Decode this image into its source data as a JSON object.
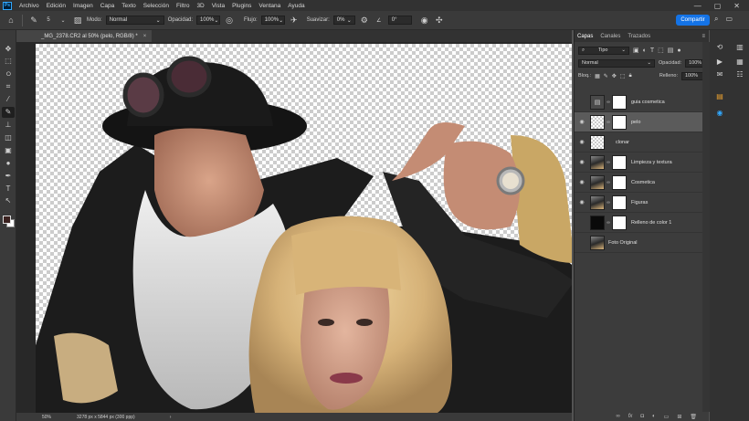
{
  "app": {
    "logo": "Ps"
  },
  "menu": [
    "Archivo",
    "Edición",
    "Imagen",
    "Capa",
    "Texto",
    "Selección",
    "Filtro",
    "3D",
    "Vista",
    "Plugins",
    "Ventana",
    "Ayuda"
  ],
  "window_controls": [
    "—",
    "▢",
    "✕"
  ],
  "options": {
    "brush_size": "5",
    "modo_label": "Modo:",
    "modo_value": "Normal",
    "opacidad_label": "Opacidad:",
    "opacidad_value": "100%",
    "flujo_label": "Flujo:",
    "flujo_value": "100%",
    "suavizar_label": "Suavizar:",
    "suavizar_value": "0%",
    "angle_value": "0°",
    "share_label": "Compartir"
  },
  "document": {
    "tab_title": "_MG_2378.CR2 al 50% (pelo, RGB/8) *",
    "close_symbol": "×",
    "zoom": "50%",
    "info": "3278 px x 5844 px (300 ppp)"
  },
  "colors": {
    "foreground": "#3b2220",
    "background": "#ffffff",
    "accent": "#1473e6"
  },
  "layers_panel": {
    "tabs": [
      "Capas",
      "Canales",
      "Trazados"
    ],
    "filter_label": "Tipo",
    "blend_mode": "Normal",
    "opacity_label": "Opacidad:",
    "opacity_value": "100%",
    "lock_label": "Bloq.:",
    "fill_label": "Relleno:",
    "fill_value": "100%",
    "layers": [
      {
        "name": "guia cosmetica",
        "visible": false,
        "selected": false,
        "thumb": "folder",
        "mask": true
      },
      {
        "name": "pelo",
        "visible": true,
        "selected": true,
        "thumb": "checker",
        "mask": true
      },
      {
        "name": "clonar",
        "visible": true,
        "selected": false,
        "thumb": "checker",
        "mask": false
      },
      {
        "name": "Limpieza y textura",
        "visible": true,
        "selected": false,
        "thumb": "photo",
        "mask": true
      },
      {
        "name": "Cosmetica",
        "visible": true,
        "selected": false,
        "thumb": "photo",
        "mask": true
      },
      {
        "name": "Figuras",
        "visible": true,
        "selected": false,
        "thumb": "photo",
        "mask": true
      },
      {
        "name": "Relleno de color 1",
        "visible": false,
        "selected": false,
        "thumb": "black",
        "mask": true
      },
      {
        "name": "Foto Original",
        "visible": false,
        "selected": false,
        "thumb": "photo",
        "mask": false
      }
    ],
    "bottom_icons": [
      "link-icon",
      "fx-icon",
      "mask-icon",
      "adjustment-icon",
      "folder-icon",
      "new-layer-icon",
      "trash-icon"
    ]
  }
}
